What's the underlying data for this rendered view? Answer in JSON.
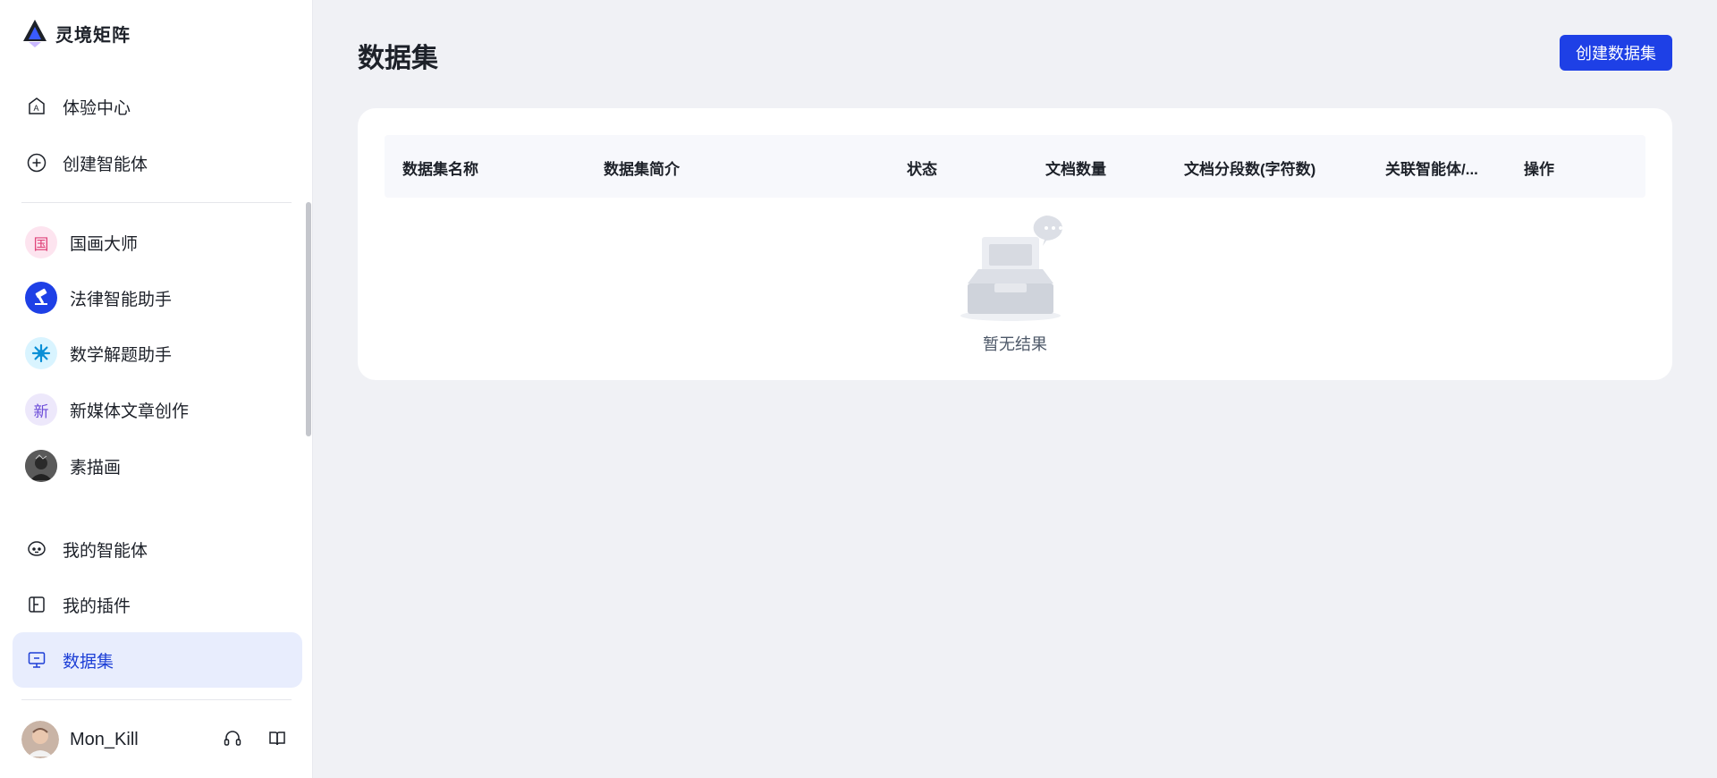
{
  "app": {
    "name": "灵境矩阵"
  },
  "sidebar": {
    "top_nav": [
      {
        "label": "体验中心",
        "icon": "explore-icon"
      },
      {
        "label": "创建智能体",
        "icon": "plus-circle-icon"
      }
    ],
    "agents": [
      {
        "label": "国画大师",
        "avatar_text": "国",
        "avatar_bg": "#fde4ef",
        "avatar_color": "#e0457b"
      },
      {
        "label": "法律智能助手",
        "avatar_text": "",
        "avatar_bg": "#1e40e6"
      },
      {
        "label": "数学解题助手",
        "avatar_text": "",
        "avatar_bg": "#d9f4ff"
      },
      {
        "label": "新媒体文章创作",
        "avatar_text": "新",
        "avatar_bg": "#ede8fb",
        "avatar_color": "#6b4bd8"
      },
      {
        "label": "素描画",
        "avatar_text": "",
        "avatar_bg": "#3a3a3a"
      }
    ],
    "bottom_nav": [
      {
        "label": "我的智能体",
        "icon": "robot-icon"
      },
      {
        "label": "我的插件",
        "icon": "plugin-icon"
      },
      {
        "label": "数据集",
        "icon": "dataset-icon",
        "active": true
      }
    ],
    "user": {
      "name": "Mon_Kill"
    }
  },
  "main": {
    "title": "数据集",
    "create_button": "创建数据集",
    "table": {
      "columns": [
        "数据集名称",
        "数据集简介",
        "状态",
        "文档数量",
        "文档分段数(字符数)",
        "关联智能体/...",
        "操作"
      ]
    },
    "empty_text": "暂无结果"
  },
  "colors": {
    "accent": "#1e40e6",
    "active_bg": "#e8edfd",
    "page_bg": "#f0f1f5"
  }
}
